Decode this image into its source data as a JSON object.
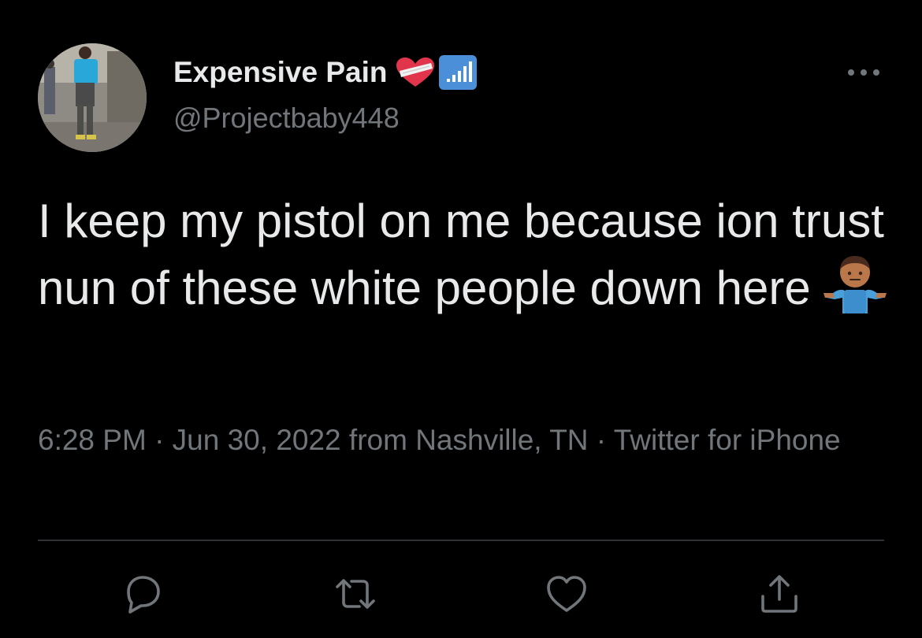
{
  "tweet": {
    "author": {
      "display_name": "Expensive Pain",
      "handle": "@Projectbaby448"
    },
    "text": "I keep my pistol on me because ion trust nun of these white people down here",
    "emoji": "person-shrugging-emoji",
    "meta": "6:28 PM · Jun 30, 2022 from Nashville, TN · Twitter for iPhone"
  },
  "icons": {
    "more": "more-dots-icon",
    "reply": "reply-icon",
    "retweet": "retweet-icon",
    "like": "heart-icon",
    "share": "share-icon",
    "heart_badge": "bandaged-heart-icon",
    "signal_badge": "signal-bars-icon"
  },
  "colors": {
    "background": "#000000",
    "text": "#e7e9ea",
    "secondary": "#71767b",
    "divider": "#2f3336",
    "signal_badge": "#4c8fd9",
    "heart_badge": "#e0354b"
  }
}
